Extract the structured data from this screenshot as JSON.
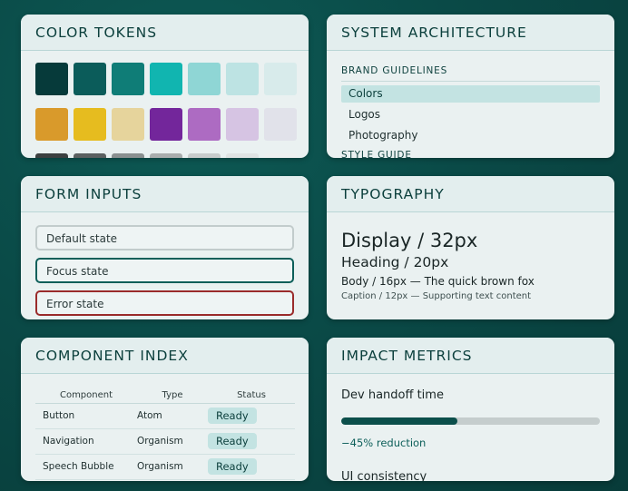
{
  "color_tokens": {
    "title": "COLOR TOKENS",
    "rows": [
      [
        "#063a3a",
        "#0b5c5a",
        "#0f7d77",
        "#11b5b0",
        "#8fd6d5",
        "#bde3e3",
        "#d8ebeb"
      ],
      [
        "#d99a2b",
        "#e6bc1f",
        "#e6d49c",
        "#73269b",
        "#ad6bc2",
        "#d6c4e3",
        "#e1e2ea"
      ],
      [
        "#3c4040",
        "#5b6060",
        "#8a9090",
        "#a9adad",
        "#c8cccc",
        "#e0e3e3",
        "#edf0f0"
      ]
    ]
  },
  "system_architecture": {
    "title": "SYSTEM ARCHITECTURE",
    "section": "BRAND GUIDELINES",
    "items": [
      "Colors",
      "Logos",
      "Photography"
    ],
    "next_section": "STYLE GUIDE"
  },
  "form_inputs": {
    "title": "FORM INPUTS",
    "default_value": "Default state",
    "focus_value": "Focus state",
    "error_value": "Error state"
  },
  "typography": {
    "title": "TYPOGRAPHY",
    "display": "Display / 32px",
    "heading": "Heading / 20px",
    "body": "Body / 16px — The quick brown fox",
    "caption": "Caption / 12px — Supporting text content"
  },
  "component_index": {
    "title": "COMPONENT INDEX",
    "columns": [
      "Component",
      "Type",
      "Status"
    ],
    "rows": [
      [
        "Button",
        "Atom",
        "Ready"
      ],
      [
        "Navigation",
        "Organism",
        "Ready"
      ],
      [
        "Speech Bubble",
        "Organism",
        "Ready"
      ]
    ]
  },
  "impact_metrics": {
    "title": "IMPACT METRICS",
    "metric1_label": "Dev handoff time",
    "metric1_progress": 0.45,
    "metric1_change": "−45% reduction",
    "metric2_label": "UI consistency"
  }
}
